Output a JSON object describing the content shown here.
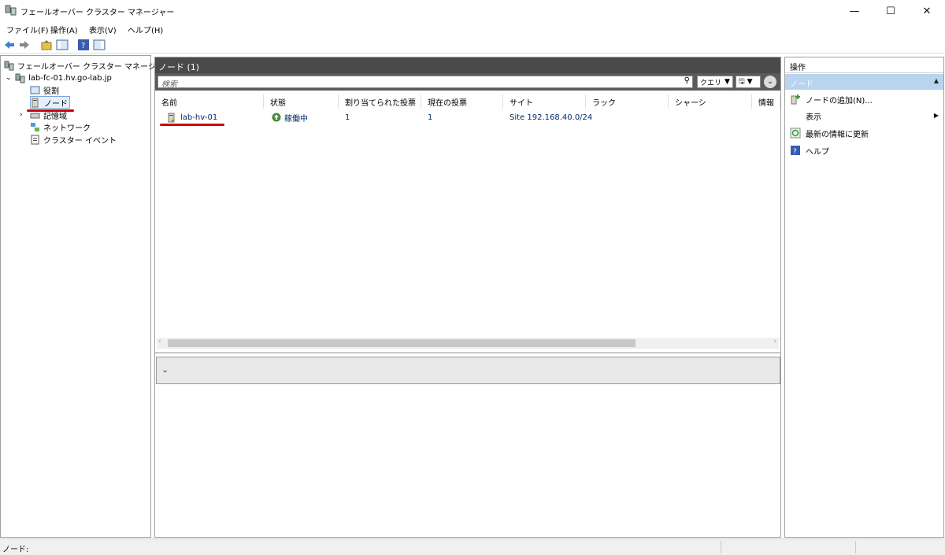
{
  "window": {
    "title": "フェールオーバー クラスター マネージャー"
  },
  "menu": [
    "ファイル(F)",
    "操作(A)",
    "表示(V)",
    "ヘルプ(H)"
  ],
  "tree": {
    "root": "フェールオーバー クラスター マネージャー",
    "cluster": "lab-fc-01.hv.go-lab.jp",
    "items": [
      "役割",
      "ノード",
      "記憶域",
      "ネットワーク",
      "クラスター イベント"
    ]
  },
  "center": {
    "title": "ノード (1)",
    "search_placeholder": "検索",
    "query_label": "クエリ",
    "columns": [
      "名前",
      "状態",
      "割り当てられた投票",
      "現在の投票",
      "サイト",
      "ラック",
      "シャーシ",
      "情報"
    ],
    "rows": [
      {
        "name": "lab-hv-01",
        "status": "稼働中",
        "assigned": "1",
        "current": "1",
        "site": "Site 192.168.40.0/24",
        "rack": "",
        "chassis": "",
        "info": ""
      }
    ]
  },
  "actions": {
    "header": "操作",
    "section": "ノード",
    "items": [
      "ノードの追加(N)...",
      "表示",
      "最新の情報に更新",
      "ヘルプ"
    ]
  },
  "status": {
    "text": "ノード:"
  },
  "colors": {
    "accent": "#b8d4ee",
    "highlight_red": "#d00000",
    "header_dark": "#4a4a4a"
  }
}
